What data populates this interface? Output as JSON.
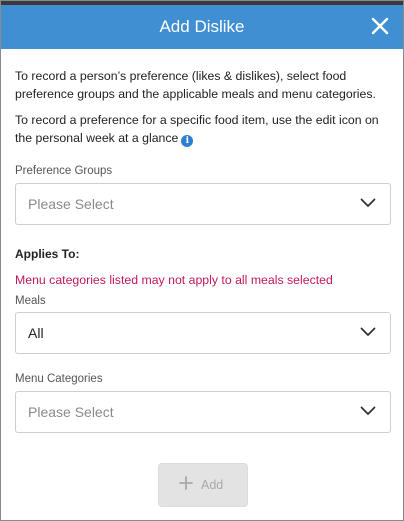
{
  "dialog": {
    "title": "Add Dislike",
    "close_icon": "close-icon"
  },
  "intro": {
    "line1": "To record a person’s preference (likes & dislikes), select food preference groups and the applicable meals and menu categories.",
    "line2": "To record a preference for a specific food item, use the edit icon on the personal week at a glance",
    "info_icon_glyph": "i"
  },
  "preference_groups": {
    "label": "Preference Groups",
    "placeholder": "Please Select"
  },
  "applies_to": {
    "heading": "Applies To:",
    "warning": "Menu categories listed may not apply to all meals selected"
  },
  "meals": {
    "label": "Meals",
    "value": "All"
  },
  "menu_categories": {
    "label": "Menu Categories",
    "placeholder": "Please Select"
  },
  "add_button": {
    "label": "Add",
    "icon": "plus-icon"
  },
  "colors": {
    "header_bg": "#3f8fd2",
    "warning_text": "#c2185b",
    "info_icon": "#2e7fd0",
    "disabled_button_bg": "#e3e3e3"
  }
}
